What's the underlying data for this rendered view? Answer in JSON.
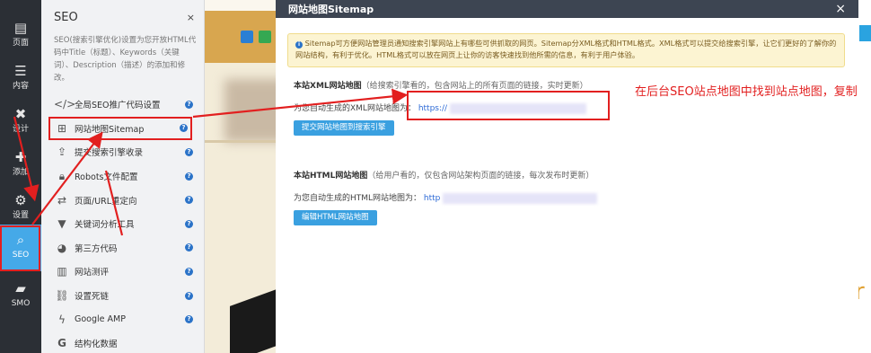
{
  "rail": {
    "items": [
      {
        "label": "页面",
        "icon": "page-icon"
      },
      {
        "label": "内容",
        "icon": "content-icon"
      },
      {
        "label": "设计",
        "icon": "design-icon"
      },
      {
        "label": "添加",
        "icon": "add-icon"
      },
      {
        "label": "设置",
        "icon": "settings-icon"
      },
      {
        "label": "SEO",
        "icon": "search-icon"
      },
      {
        "label": "SMO",
        "icon": "briefcase-icon"
      }
    ]
  },
  "panel": {
    "title": "SEO",
    "close": "×",
    "description": "SEO(搜索引擎优化)设置为您开放HTML代码中Title（标题）、Keywords（关键词）、Description（描述）的添加和修改。",
    "items": [
      {
        "label": "全局SEO推广代码设置",
        "icon": "code-icon"
      },
      {
        "label": "网站地图Sitemap",
        "icon": "sitemap-icon"
      },
      {
        "label": "提交搜索引擎收录",
        "icon": "submit-icon"
      },
      {
        "label": "Robots文件配置",
        "icon": "lock-icon"
      },
      {
        "label": "页面/URL重定向",
        "icon": "redirect-icon"
      },
      {
        "label": "关键词分析工具",
        "icon": "filter-icon"
      },
      {
        "label": "第三方代码",
        "icon": "palette-icon"
      },
      {
        "label": "网站测评",
        "icon": "bar-chart-icon"
      },
      {
        "label": "设置死链",
        "icon": "broken-link-icon"
      },
      {
        "label": "Google AMP",
        "icon": "lightning-icon"
      },
      {
        "label": "结构化数据",
        "icon": "google-icon"
      }
    ],
    "help": "?"
  },
  "modal": {
    "title": "网站地图Sitemap",
    "close": "×",
    "notice": "Sitemap可方便网站管理员通知搜索引擎网站上有哪些可供抓取的网页。Sitemap分XML格式和HTML格式。XML格式可以提交给搜索引擎，让它们更好的了解你的网站结构，有利于优化。HTML格式可以放在网页上让你的访客快速找到他所需的信息，有利于用户体验。",
    "xml": {
      "title": "本站XML网站地图",
      "subtitle": "（给搜索引擎看的，包含网站上的所有页面的链接，实时更新）",
      "label": "为您自动生成的XML网站地图为：",
      "url_prefix": "https://",
      "button": "提交网站地图到搜索引擎"
    },
    "html": {
      "title": "本站HTML网站地图",
      "subtitle": "（给用户看的，仅包含网站架构页面的链接，每次发布时更新）",
      "label": "为您自动生成的HTML网站地图为：",
      "url_prefix": "http",
      "button": "编辑HTML网站地图"
    }
  },
  "annotation": {
    "text": "在后台SEO站点地图中找到站点地图，复制",
    "color": "#e21f1f"
  },
  "colors": {
    "rail_bg": "#2b2f35",
    "rail_active": "#45a9e8",
    "modal_header": "#3d4552",
    "button": "#3aa0e0",
    "link": "#2d6ad6",
    "notice_bg": "#fcf4d2"
  }
}
